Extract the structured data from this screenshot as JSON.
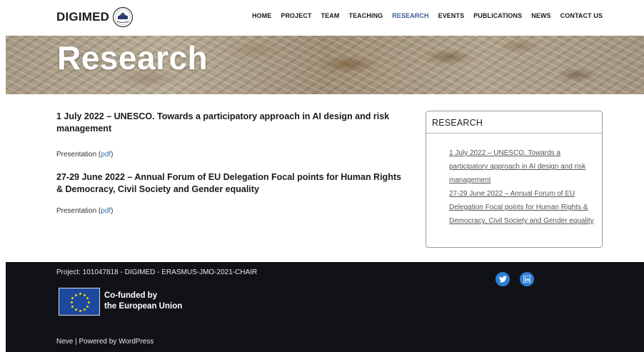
{
  "header": {
    "logo_text": "DIGIMED",
    "nav": [
      {
        "label": "HOME"
      },
      {
        "label": "PROJECT"
      },
      {
        "label": "TEAM"
      },
      {
        "label": "TEACHING"
      },
      {
        "label": "RESEARCH",
        "active": true
      },
      {
        "label": "EVENTS"
      },
      {
        "label": "PUBLICATIONS"
      },
      {
        "label": "NEWS"
      },
      {
        "label": "CONTACT US"
      }
    ]
  },
  "hero": {
    "title": "Research"
  },
  "posts": [
    {
      "title": "1 July 2022 – UNESCO. Towards a participatory approach in AI design and risk management",
      "body_prefix": "Presentation (",
      "link": "pdf",
      "body_suffix": ")"
    },
    {
      "title": "27-29 June 2022 – Annual Forum of EU Delegation Focal points for Human Rights & Democracy, Civil Society and Gender equality",
      "body_prefix": "Presentation (",
      "link": "pdf",
      "body_suffix": ")"
    }
  ],
  "sidebar": {
    "title": "RESEARCH",
    "items": [
      {
        "label": "1 July 2022 – UNESCO. Towards a participatory approach in AI design and risk management"
      },
      {
        "label": "27-29 June 2022 – Annual Forum of EU Delegation Focal points for Human Rights & Democracy, Civil Society and Gender equality"
      }
    ]
  },
  "footer": {
    "project": "Project: 101047818 - DIGIMED - ERASMUS-JMO-2021-CHAIR",
    "eu_line1": "Co-funded by",
    "eu_line2": "the European Union",
    "credit": "Neve | Powered by WordPress",
    "social": [
      {
        "icon": "twitter-icon"
      },
      {
        "icon": "linkedin-icon"
      }
    ]
  },
  "colors": {
    "nav_active": "#3a5a9a",
    "link": "#3a6fb0",
    "footer_bg": "#111217",
    "social_bg": "#2d7fd6",
    "eu_blue": "#1d4aa0",
    "eu_star": "#f5d000"
  }
}
